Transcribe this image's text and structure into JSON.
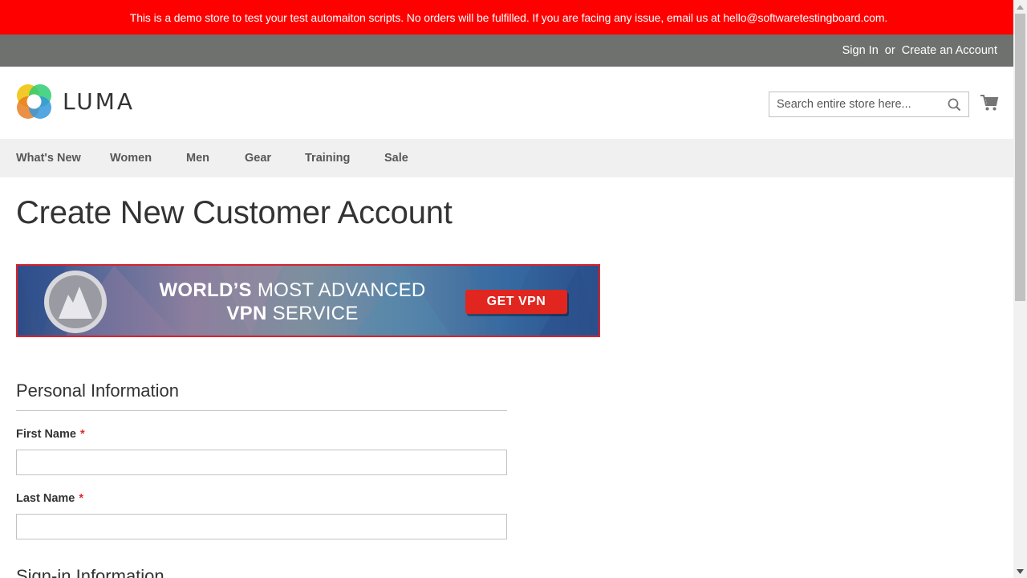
{
  "demo_notice": {
    "text": "This is a demo store to test your test automaiton scripts. No orders will be fulfilled. If you are facing any issue, email us at hello@softwaretestingboard.com."
  },
  "top_links": {
    "sign_in": "Sign In",
    "or": "or",
    "create_account": "Create an Account"
  },
  "header": {
    "logo_text": "LUMA",
    "search_placeholder": "Search entire store here...",
    "search_icon": "magnifier-icon",
    "cart_icon": "shopping-cart-icon"
  },
  "nav": {
    "items": [
      {
        "label": "What's New"
      },
      {
        "label": "Women"
      },
      {
        "label": "Men"
      },
      {
        "label": "Gear"
      },
      {
        "label": "Training"
      },
      {
        "label": "Sale"
      }
    ]
  },
  "main": {
    "page_title": "Create New Customer Account",
    "banner": {
      "line1_bold": "WORLD’S",
      "line1_rest": " MOST ADVANCED",
      "line2_bold": "VPN",
      "line2_rest": " SERVICE",
      "button": "GET VPN"
    },
    "personal_info": {
      "title": "Personal Information",
      "first_name_label": "First Name",
      "last_name_label": "Last Name",
      "required_mark": "*",
      "first_name_value": "",
      "last_name_value": ""
    },
    "next_section_title": "Sign-in Information"
  },
  "colors": {
    "notice_bg": "#ff0000",
    "top_bar_bg": "#6e716e",
    "nav_bg": "#f0f0f0",
    "required": "#e02b27",
    "banner_button": "#e0261f"
  }
}
